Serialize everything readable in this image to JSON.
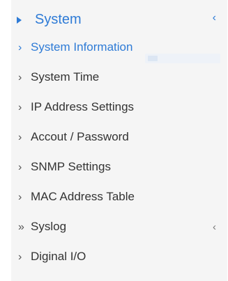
{
  "menu": {
    "section": {
      "label": "System",
      "collapse_glyph": "‹",
      "expand_icon": "triangle-right-icon"
    },
    "items": [
      {
        "label": "System Information",
        "glyph": "›",
        "active": true
      },
      {
        "label": "System Time",
        "glyph": "›"
      },
      {
        "label": "IP Address Settings",
        "glyph": "›"
      },
      {
        "label": "Accout / Password",
        "glyph": "›"
      },
      {
        "label": "SNMP Settings",
        "glyph": "›"
      },
      {
        "label": "MAC Address Table",
        "glyph": "›"
      },
      {
        "label": "Syslog",
        "glyph": "»",
        "submenu_glyph": "‹"
      },
      {
        "label": "Diginal I/O",
        "glyph": "›"
      }
    ]
  },
  "colors": {
    "accent": "#2e7bd6",
    "panel_background": "#f5f5f5",
    "text": "#333333"
  }
}
